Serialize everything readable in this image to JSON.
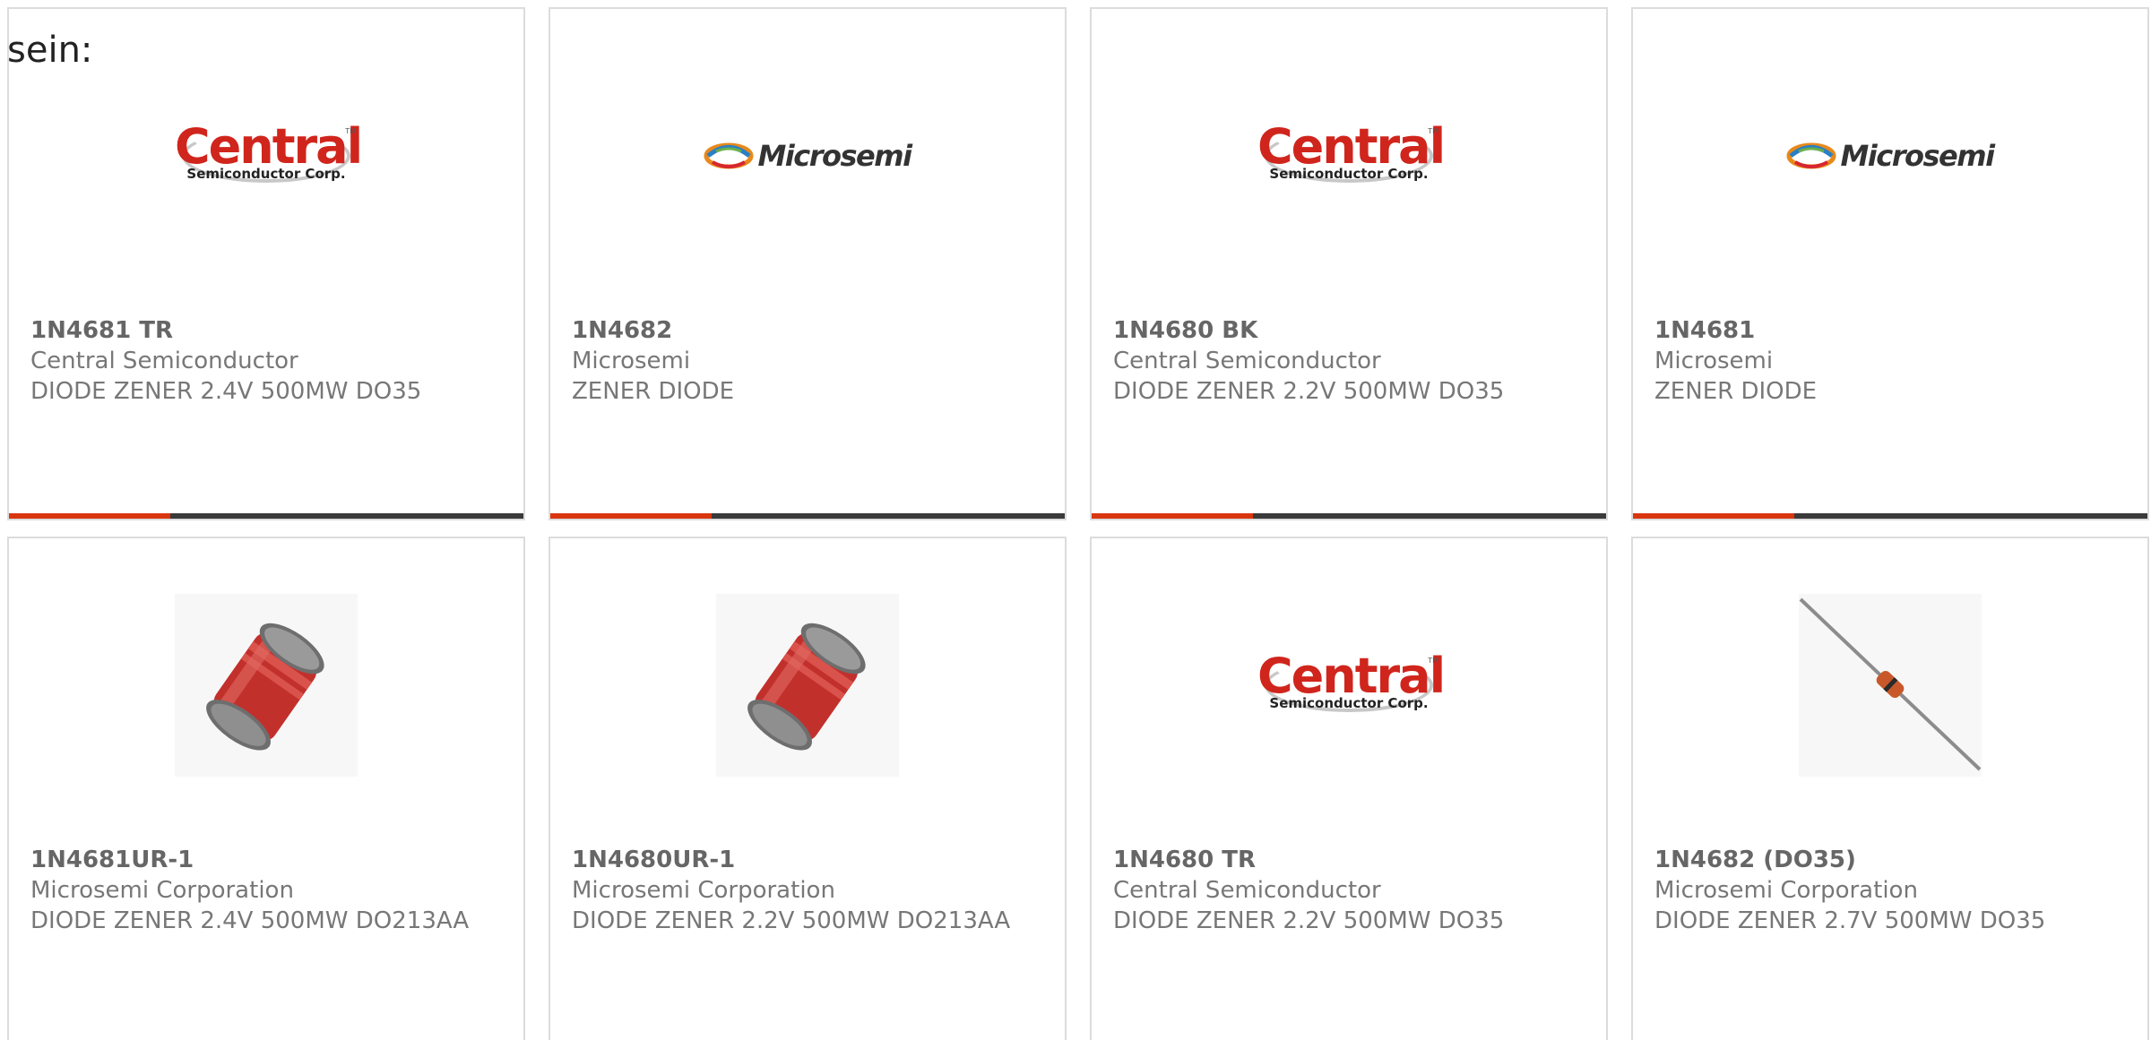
{
  "intro": {
    "text": "sein:"
  },
  "colors": {
    "accent": "#d9360f",
    "bar": "#3a3a3a",
    "border": "#dcdcdc",
    "text": "#777777"
  },
  "products": [
    {
      "part": "1N4681 TR",
      "maker": "Central Semiconductor",
      "description": "DIODE ZENER 2.4V 500MW DO35",
      "image": "central-logo",
      "logo_text": "Central",
      "logo_subtext": "Semiconductor Corp."
    },
    {
      "part": "1N4682",
      "maker": "Microsemi",
      "description": "ZENER DIODE",
      "image": "microsemi-logo",
      "logo_text": "Microsemi"
    },
    {
      "part": "1N4680 BK",
      "maker": "Central Semiconductor",
      "description": "DIODE ZENER 2.2V 500MW DO35",
      "image": "central-logo",
      "logo_text": "Central",
      "logo_subtext": "Semiconductor Corp."
    },
    {
      "part": "1N4681",
      "maker": "Microsemi",
      "description": "ZENER DIODE",
      "image": "microsemi-logo",
      "logo_text": "Microsemi"
    },
    {
      "part": "1N4681UR-1",
      "maker": "Microsemi Corporation",
      "description": "DIODE ZENER 2.4V 500MW DO213AA",
      "image": "melf-diode-photo"
    },
    {
      "part": "1N4680UR-1",
      "maker": "Microsemi Corporation",
      "description": "DIODE ZENER 2.2V 500MW DO213AA",
      "image": "melf-diode-photo"
    },
    {
      "part": "1N4680 TR",
      "maker": "Central Semiconductor",
      "description": "DIODE ZENER 2.2V 500MW DO35",
      "image": "central-logo",
      "logo_text": "Central",
      "logo_subtext": "Semiconductor Corp."
    },
    {
      "part": "1N4682 (DO35)",
      "maker": "Microsemi Corporation",
      "description": "DIODE ZENER 2.7V 500MW DO35",
      "image": "axial-diode-photo"
    }
  ]
}
